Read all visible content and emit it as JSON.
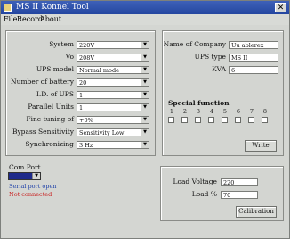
{
  "window": {
    "title": "MS II Konnel Tool",
    "close_symbol": "✕"
  },
  "menu": {
    "file": "File",
    "record": "Record",
    "about": "About"
  },
  "settings": {
    "system_label": "System",
    "system_value": "220V",
    "vo_label": "Vo",
    "vo_value": "208V",
    "ups_model_label": "UPS model",
    "ups_model_value": "Normal mode",
    "battery_label": "Number of battery",
    "battery_value": "20",
    "id_label": "I.D. of UPS",
    "id_value": "1",
    "parallel_label": "Parallel Units",
    "parallel_value": "1",
    "fine_tuning_label": "Fine tuning of",
    "fine_tuning_value": "+0%",
    "bypass_label": "Bypass Sensitivity",
    "bypass_value": "Sensitivity Low",
    "sync_label": "Synchronizing",
    "sync_value": "3 Hz"
  },
  "info": {
    "company_label": "Name of Company",
    "company_value": "Uu ablerex",
    "ups_type_label": "UPS type",
    "ups_type_value": "MS II",
    "kva_label": "KVA",
    "kva_value": "6"
  },
  "special": {
    "title": "Special function",
    "numbers": [
      "1",
      "2",
      "3",
      "4",
      "5",
      "6",
      "7",
      "8"
    ],
    "write_label": "Write"
  },
  "com": {
    "label": "Com Port",
    "status_open": "Serial port open",
    "status_conn": "Not connected",
    "colors": {
      "open": "#1c3fa8",
      "conn": "#c81e1e",
      "combo_bg": "#1e2a8a"
    }
  },
  "load": {
    "voltage_label": "Load Voltage",
    "voltage_value": "220",
    "percent_label": "Load %",
    "percent_value": "70",
    "calibration_label": "Calibration"
  }
}
